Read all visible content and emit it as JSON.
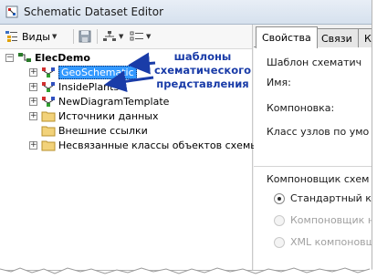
{
  "window": {
    "title": "Schematic Dataset Editor"
  },
  "toolbar": {
    "views_label": "Виды"
  },
  "tree": {
    "root": "ElecDemo",
    "items": [
      {
        "label": "GeoSchematic",
        "selected": true
      },
      {
        "label": "InsidePlants"
      },
      {
        "label": "NewDiagramTemplate"
      },
      {
        "label": "Источники данных"
      },
      {
        "label": "Внешние ссылки"
      },
      {
        "label": "Несвязанные классы объектов схемы"
      }
    ]
  },
  "annotation": {
    "lines": [
      "шаблоны",
      "схематического",
      "представления"
    ]
  },
  "tabs": {
    "properties": "Свойства",
    "links": "Связи",
    "third": "К"
  },
  "panel": {
    "template_label": "Шаблон схематич",
    "name_label": "Имя:",
    "layout_label": "Компоновка:",
    "node_class_label": "Класс узлов по умо",
    "layout_engine_label": "Компоновщик схем",
    "radio_standard": "Стандартный к",
    "radio_engine": "Компоновщик на",
    "radio_xml": "XML  компоновщ"
  },
  "colors": {
    "accent": "#3399ff",
    "annotation": "#1a3ca8"
  }
}
